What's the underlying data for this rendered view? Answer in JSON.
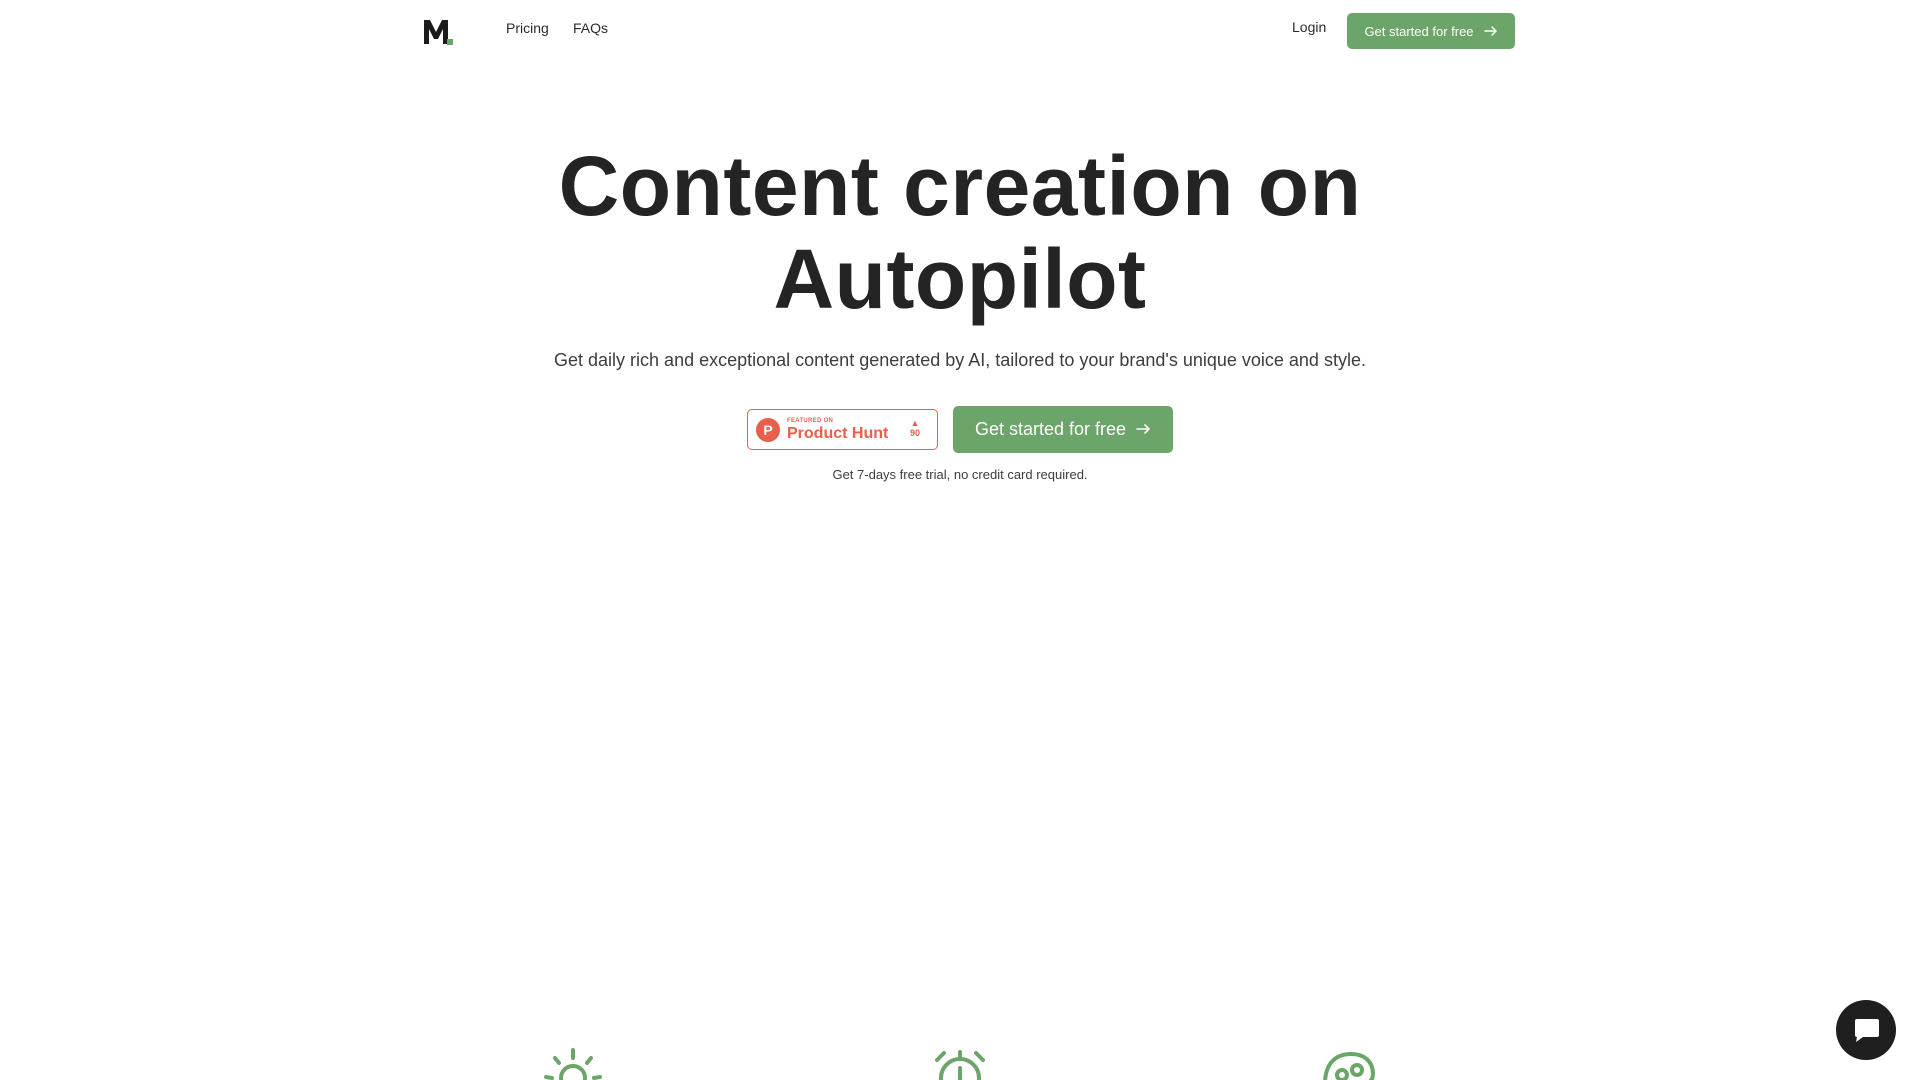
{
  "nav": {
    "logo_icon": "m-logo-icon",
    "links": [
      {
        "label": "Pricing"
      },
      {
        "label": "FAQs"
      }
    ],
    "login_label": "Login",
    "cta_label": "Get started for free",
    "cta_icon": "arrow-right-icon"
  },
  "hero": {
    "title_line1": "Content creation on",
    "title_line2": "Autopilot",
    "subtitle": "Get daily rich and exceptional content generated by AI, tailored to your brand's unique voice and style.",
    "product_hunt": {
      "featured_label": "FEATURED ON",
      "name": "Product Hunt",
      "letter": "P",
      "upvote_count": "90"
    },
    "cta_label": "Get started for free",
    "trial_note": "Get 7-days free trial, no credit card required."
  },
  "features": {
    "icons": [
      "sun-icon",
      "alarm-clock-icon",
      "palette-icon"
    ]
  },
  "chat": {
    "icon": "chat-bubble-icon"
  },
  "colors": {
    "accent_green": "#6ca56a",
    "product_hunt_red": "#e8604c",
    "text_dark": "#242424",
    "chat_bg": "#1f1f1f"
  }
}
